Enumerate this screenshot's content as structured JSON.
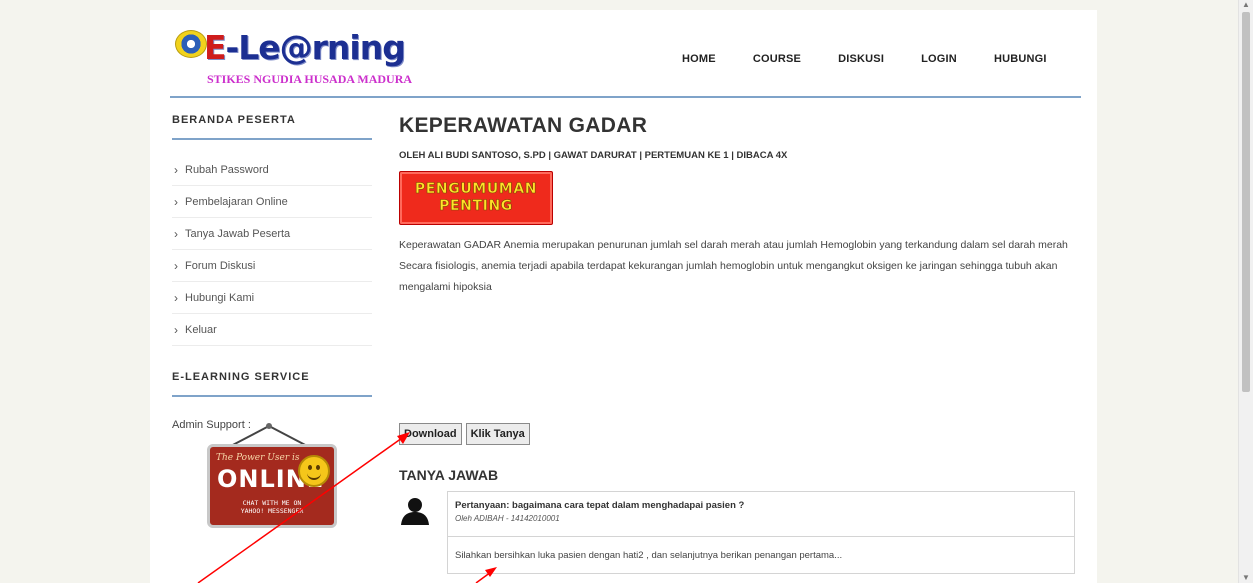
{
  "header": {
    "logo_text": "E-Le@rning",
    "logo_text_e": "E",
    "logo_text_rest": "-Le@rning",
    "logo_subtitle": "STIKES NGUDIA HUSADA MADURA",
    "nav": [
      "HOME",
      "COURSE",
      "DISKUSI",
      "LOGIN",
      "HUBUNGI"
    ]
  },
  "sidebar": {
    "section1_title": "BERANDA PESERTA",
    "items": [
      "Rubah Password",
      "Pembelajaran Online",
      "Tanya Jawab Peserta",
      "Forum Diskusi",
      "Hubungi Kami",
      "Keluar"
    ],
    "section2_title": "E-LEARNING SERVICE",
    "admin_label": "Admin Support :",
    "badge": {
      "small_text": "The Power User is",
      "big_text": "ONLINE",
      "footer_line1": "CHAT WITH ME ON",
      "footer_line2": "YAHOO! MESSENGER"
    }
  },
  "main": {
    "title": "KEPERAWATAN GADAR",
    "meta": "OLEH ALI BUDI SANTOSO, S.PD | GAWAT DARURAT | PERTEMUAN KE 1 | DIBACA 4X",
    "banner_line1": "PENGUMUMAN",
    "banner_line2": "PENTING",
    "body": "Keperawatan GADAR Anemia merupakan penurunan jumlah sel darah merah atau jumlah Hemoglobin yang terkandung dalam sel darah merah Secara fisiologis, anemia terjadi apabila terdapat kekurangan jumlah hemoglobin untuk mengangkut oksigen ke jaringan sehingga tubuh akan mengalami hipoksia",
    "buttons": {
      "download": "Download",
      "ask": "Klik Tanya"
    },
    "qa_title": "TANYA JAWAB",
    "qa": {
      "question": "Pertanyaan: bagaimana cara tepat dalam menghadapai pasien ?",
      "author": "Oleh ADIBAH - 14142010001",
      "answer": "Silahkan bersihkan luka pasien dengan hati2 , dan selanjutnya berikan penangan pertama..."
    }
  },
  "colors": {
    "accent_line": "#7fa3c9",
    "banner_red": "#ef2a1c",
    "banner_yellow": "#ffe22a",
    "annotation_arrow": "#ff0000"
  }
}
